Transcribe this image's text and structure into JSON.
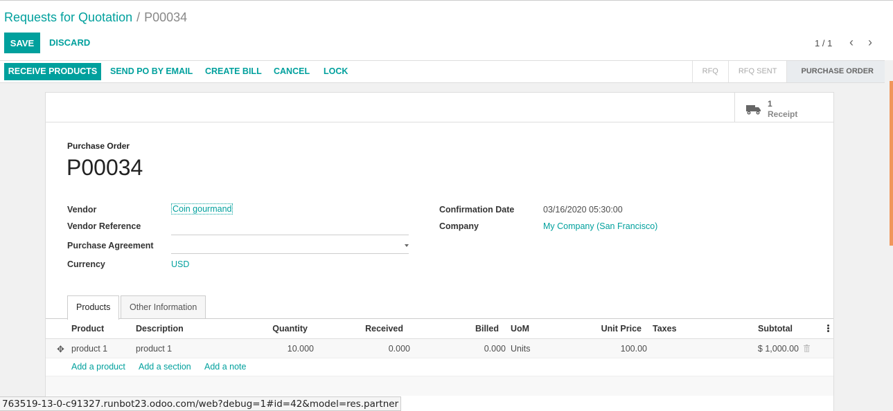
{
  "breadcrumb": {
    "parent": "Requests for Quotation",
    "separator": "/",
    "current": "P00034"
  },
  "toolbar": {
    "save_label": "SAVE",
    "discard_label": "DISCARD",
    "pager": "1 / 1",
    "prev_icon": "‹",
    "next_icon": "›"
  },
  "header": {
    "buttons": [
      "RECEIVE PRODUCTS",
      "SEND PO BY EMAIL",
      "CREATE BILL",
      "CANCEL",
      "LOCK"
    ],
    "status_steps": [
      "RFQ",
      "RFQ SENT",
      "PURCHASE ORDER"
    ],
    "active_step": "PURCHASE ORDER"
  },
  "smart_button": {
    "icon": "truck-icon",
    "value": "1",
    "label": "Receipt"
  },
  "form": {
    "caption": "Purchase Order",
    "name": "P00034",
    "vendor_label": "Vendor",
    "vendor_value": "Coin gourmand",
    "vendor_ref_label": "Vendor Reference",
    "vendor_ref_value": "",
    "agreement_label": "Purchase Agreement",
    "agreement_value": "",
    "currency_label": "Currency",
    "currency_value": "USD",
    "confirmation_label": "Confirmation Date",
    "confirmation_value": "03/16/2020 05:30:00",
    "company_label": "Company",
    "company_value": "My Company (San Francisco)"
  },
  "tabs": [
    {
      "label": "Products",
      "active": true
    },
    {
      "label": "Other Information",
      "active": false
    }
  ],
  "table": {
    "columns": [
      "Product",
      "Description",
      "Quantity",
      "Received",
      "Billed",
      "UoM",
      "Unit Price",
      "Taxes",
      "Subtotal"
    ],
    "rows": [
      {
        "product": "product 1",
        "description": "product 1",
        "quantity": "10.000",
        "received": "0.000",
        "billed": "0.000",
        "uom": "Units",
        "unit_price": "100.00",
        "taxes": "",
        "subtotal": "$ 1,000.00"
      }
    ],
    "add_links": [
      "Add a product",
      "Add a section",
      "Add a note"
    ]
  },
  "status_url": "763519-13-0-c91327.runbot23.odoo.com/web?debug=1#id=42&model=res.partner",
  "colors": {
    "accent": "#00a09d",
    "scroll_thumb": "#f0965b"
  }
}
